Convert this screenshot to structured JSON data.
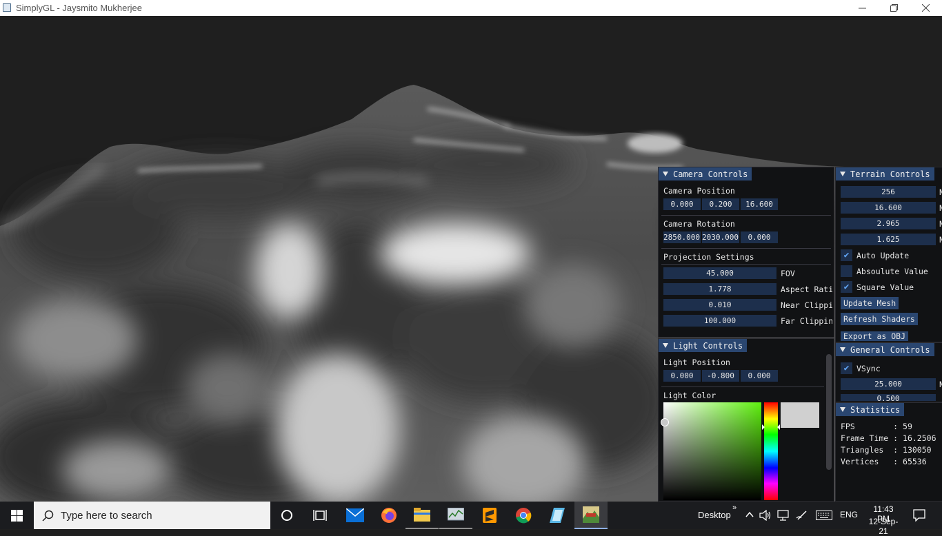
{
  "window": {
    "title": "SimplyGL - Jaysmito Mukherjee"
  },
  "camera_controls": {
    "title": "Camera Controls",
    "position_label": "Camera Position",
    "position": [
      "0.000",
      "0.200",
      "16.600"
    ],
    "rotation_label": "Camera Rotation",
    "rotation": [
      "2850.000",
      "2030.000",
      "0.000"
    ],
    "projection_label": "Projection Settings",
    "fov": {
      "value": "45.000",
      "label": "FOV"
    },
    "aspect": {
      "value": "1.778",
      "label": "Aspect Ratio"
    },
    "near": {
      "value": "0.010",
      "label": "Near Clipping"
    },
    "far": {
      "value": "100.000",
      "label": "Far Clipping"
    }
  },
  "light_controls": {
    "title": "Light Controls",
    "position_label": "Light Position",
    "position": [
      "0.000",
      "-0.800",
      "0.000"
    ],
    "color_label": "Light Color",
    "preview_color": "#d0d0d0",
    "hue_color": "#5ef00e"
  },
  "terrain_controls": {
    "title": "Terrain Controls",
    "values": [
      "256",
      "16.600",
      "2.965",
      "1.625"
    ],
    "cut_label": "N",
    "auto_update": {
      "label": "Auto Update",
      "checked": true
    },
    "absolute_value": {
      "label": "Absoulute Value",
      "checked": false
    },
    "square_value": {
      "label": "Square Value",
      "checked": true
    },
    "update_mesh": "Update Mesh",
    "refresh_shaders": "Refresh Shaders",
    "export_obj": "Export as OBJ"
  },
  "general_controls": {
    "title": "General Controls",
    "vsync": {
      "label": "VSync",
      "checked": true
    },
    "values": [
      "25.000",
      "0.500"
    ]
  },
  "statistics": {
    "title": "Statistics",
    "rows": [
      {
        "key": "FPS        ",
        "value": "59"
      },
      {
        "key": "Frame Time ",
        "value": "16.2506"
      },
      {
        "key": "Triangles  ",
        "value": "130050"
      },
      {
        "key": "Vertices   ",
        "value": "65536"
      }
    ]
  },
  "taskbar": {
    "search_placeholder": "Type here to search",
    "desktop_label": "Desktop",
    "chevron": "»",
    "language": "ENG",
    "time": "11:43 PM",
    "date": "12-Sep-21"
  }
}
